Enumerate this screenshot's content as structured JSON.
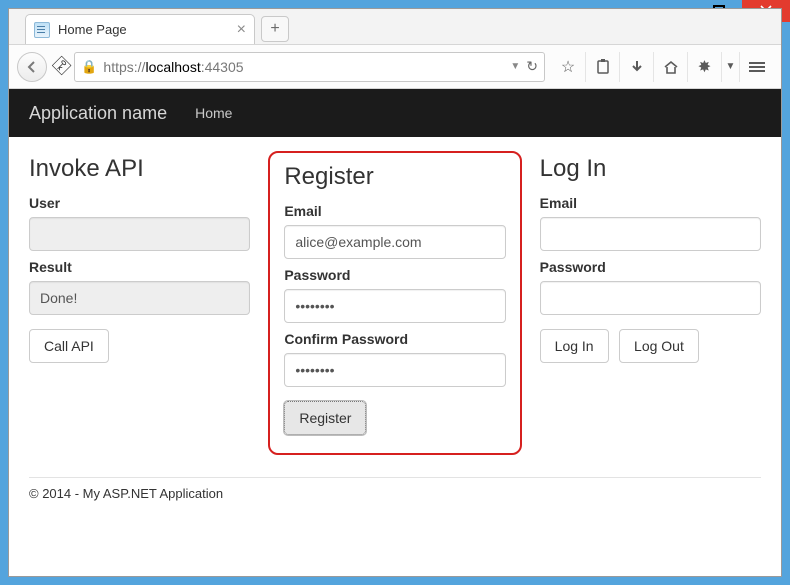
{
  "window": {
    "tab_title": "Home Page",
    "url_scheme": "https://",
    "url_host": "localhost",
    "url_port": ":44305"
  },
  "appnav": {
    "brand": "Application name",
    "home": "Home"
  },
  "invoke": {
    "heading": "Invoke API",
    "user_label": "User",
    "user_value": "",
    "result_label": "Result",
    "result_value": "Done!",
    "call_btn": "Call API"
  },
  "register": {
    "heading": "Register",
    "email_label": "Email",
    "email_value": "alice@example.com",
    "password_label": "Password",
    "password_value": "••••••••",
    "confirm_label": "Confirm Password",
    "confirm_value": "••••••••",
    "submit_btn": "Register"
  },
  "login": {
    "heading": "Log In",
    "email_label": "Email",
    "email_value": "",
    "password_label": "Password",
    "password_value": "",
    "login_btn": "Log In",
    "logout_btn": "Log Out"
  },
  "footer": "© 2014 - My ASP.NET Application"
}
